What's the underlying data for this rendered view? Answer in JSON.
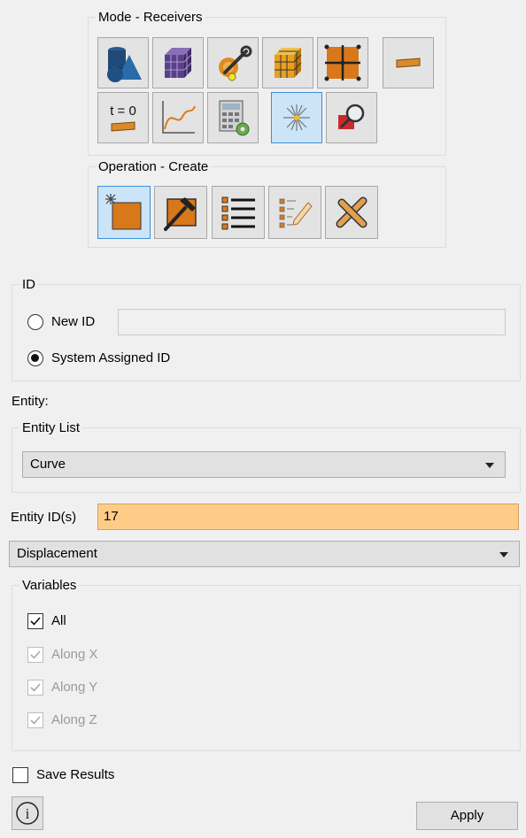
{
  "mode_group": {
    "title": "Mode - Receivers",
    "buttons": [
      {
        "icon": "geometry-icon"
      },
      {
        "icon": "mesh-cube-icon"
      },
      {
        "icon": "tools-wrench-icon"
      },
      {
        "icon": "grid-cube-icon"
      },
      {
        "icon": "grid-square-icon"
      },
      {
        "icon": "wedge-icon"
      },
      {
        "icon": "initial-condition-icon",
        "text": "t = 0"
      },
      {
        "icon": "curve-graph-icon"
      },
      {
        "icon": "calculator-gear-icon"
      },
      {
        "icon": "receiver-starburst-icon",
        "active": true
      },
      {
        "icon": "magnifier-icon"
      }
    ]
  },
  "operation_group": {
    "title": "Operation - Create",
    "buttons": [
      {
        "icon": "create-spark-icon",
        "active": true
      },
      {
        "icon": "modify-hammer-icon"
      },
      {
        "icon": "list-icon"
      },
      {
        "icon": "edit-list-icon"
      },
      {
        "icon": "delete-x-icon"
      }
    ]
  },
  "id_group": {
    "title": "ID",
    "new_id_label": "New ID",
    "new_id_value": "",
    "system_id_label": "System Assigned ID",
    "selected": "system"
  },
  "entity": {
    "label": "Entity:",
    "list_group_title": "Entity List",
    "list_value": "Curve",
    "ids_label": "Entity ID(s)",
    "ids_value": "17"
  },
  "result_type": "Displacement",
  "variables": {
    "title": "Variables",
    "items": [
      {
        "label": "All",
        "checked": true,
        "enabled": true
      },
      {
        "label": "Along X",
        "checked": true,
        "enabled": false
      },
      {
        "label": "Along Y",
        "checked": true,
        "enabled": false
      },
      {
        "label": "Along Z",
        "checked": true,
        "enabled": false
      }
    ]
  },
  "save_results": {
    "label": "Save Results",
    "checked": false
  },
  "apply_label": "Apply",
  "info_glyph": "i",
  "t0_text": "t = 0",
  "colors": {
    "accent": "#3c8fd6",
    "active_bg": "#cce4f7",
    "highlight_input": "#ffcc88",
    "panel_bg": "#f0f0f0"
  }
}
